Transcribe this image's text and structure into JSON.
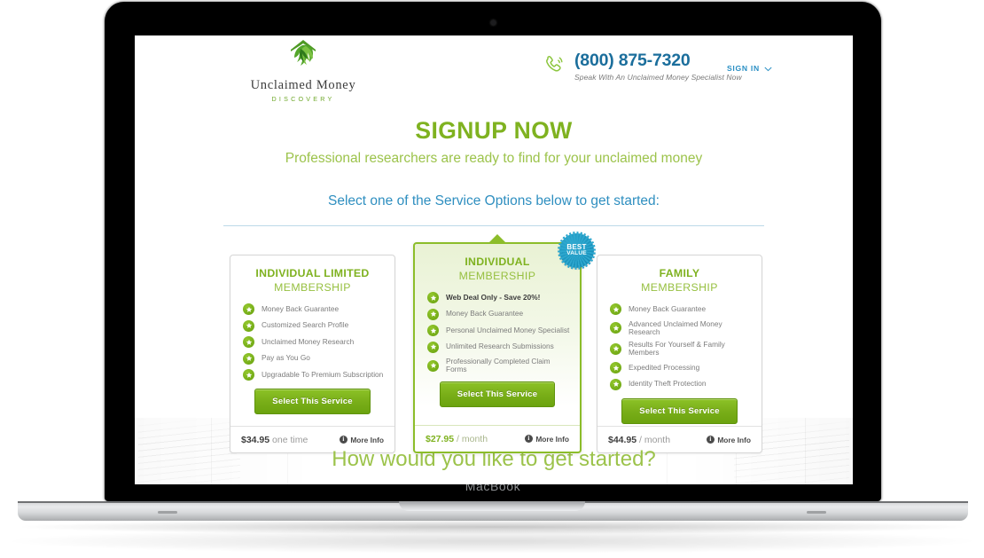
{
  "device": {
    "brand_label": "MacBook",
    "camera_icon": "camera-dot"
  },
  "header": {
    "logo": {
      "icon": "tree-leaf-logo-icon",
      "name": "Unclaimed Money",
      "sub": "DISCOVERY"
    },
    "phone": {
      "icon": "phone-ring-icon",
      "number": "(800) 875-7320",
      "tagline": "Speak With An Unclaimed Money Specialist Now"
    },
    "signin": {
      "label": "SIGN IN",
      "chevron_icon": "chevron-down-icon"
    }
  },
  "hero": {
    "title": "SIGNUP NOW",
    "subtitle": "Professional researchers are ready to find for your unclaimed money",
    "select_prompt": "Select one of the Service Options below to get started:"
  },
  "cards": [
    {
      "id": "individual-limited",
      "title": "INDIVIDUAL LIMITED",
      "subtitle": "MEMBERSHIP",
      "featured": false,
      "features": [
        {
          "text": "Money Back Guarantee",
          "bold": false
        },
        {
          "text": "Customized Search Profile",
          "bold": false
        },
        {
          "text": "Unclaimed Money Research",
          "bold": false
        },
        {
          "text": "Pay as You Go",
          "bold": false
        },
        {
          "text": "Upgradable To Premium Subscription",
          "bold": false
        }
      ],
      "cta": "Select This Service",
      "price": "$34.95",
      "period": "one time",
      "more_info": "More Info"
    },
    {
      "id": "individual",
      "title": "INDIVIDUAL",
      "subtitle": "MEMBERSHIP",
      "featured": true,
      "badge_line1": "BEST",
      "badge_line2": "VALUE",
      "features": [
        {
          "text": "Web Deal Only - Save 20%!",
          "bold": true
        },
        {
          "text": "Money Back Guarantee",
          "bold": false
        },
        {
          "text": "Personal Unclaimed Money Specialist",
          "bold": false
        },
        {
          "text": "Unlimited Research Submissions",
          "bold": false
        },
        {
          "text": "Professionally Completed Claim Forms",
          "bold": false
        }
      ],
      "cta": "Select This Service",
      "price": "$27.95",
      "period": "/ month",
      "more_info": "More Info"
    },
    {
      "id": "family",
      "title": "FAMILY",
      "subtitle": "MEMBERSHIP",
      "featured": false,
      "features": [
        {
          "text": "Money Back Guarantee",
          "bold": false
        },
        {
          "text": "Advanced Unclaimed Money Research",
          "bold": false
        },
        {
          "text": "Results For Yourself & Family Members",
          "bold": false
        },
        {
          "text": "Expedited Processing",
          "bold": false
        },
        {
          "text": "Identity Theft Protection",
          "bold": false
        }
      ],
      "cta": "Select This Service",
      "price": "$44.95",
      "period": "/ month",
      "more_info": "More Info"
    }
  ],
  "footer": {
    "question": "How would you like to get started?"
  },
  "colors": {
    "brand_green": "#7fb220",
    "light_green": "#9cc34b",
    "button_green": "#79ae18",
    "blue": "#2f8fc0",
    "phone_blue": "#1b6e9c",
    "badge_teal": "#1b93bd",
    "grey_text": "#7c7c7c"
  }
}
